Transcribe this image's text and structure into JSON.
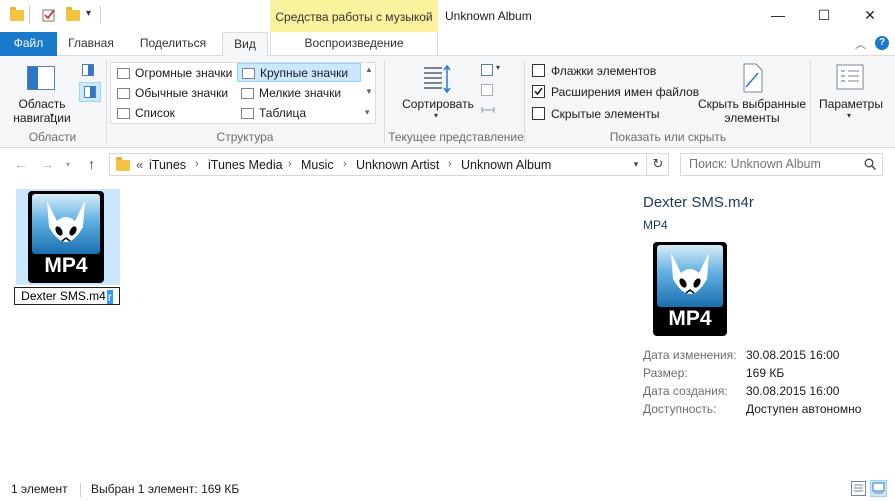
{
  "window": {
    "title": "Unknown Album",
    "context_tab_group": "Средства работы с музыкой",
    "minimize": "—",
    "maximize": "☐",
    "close": "✕"
  },
  "ribbon_tabs": {
    "file": "Файл",
    "home": "Главная",
    "share": "Поделиться",
    "view": "Вид",
    "playback": "Воспроизведение"
  },
  "ribbon": {
    "panes": {
      "nav_pane_label": "Область навигации",
      "group": "Области"
    },
    "layout": {
      "group": "Структура",
      "items": [
        "Огромные значки",
        "Крупные значки",
        "Обычные значки",
        "Мелкие значки",
        "Список",
        "Таблица"
      ],
      "selected": "Крупные значки"
    },
    "current_view": {
      "sort_label": "Сортировать",
      "group": "Текущее представление"
    },
    "show_hide": {
      "group": "Показать или скрыть",
      "checkboxes": [
        {
          "label": "Флажки элементов",
          "checked": false
        },
        {
          "label": "Расширения имен файлов",
          "checked": true
        },
        {
          "label": "Скрытые элементы",
          "checked": false
        }
      ],
      "hide_selected_label": "Скрыть выбранные элементы"
    },
    "options_label": "Параметры"
  },
  "address": {
    "prefix": "«",
    "crumbs": [
      "iTunes",
      "iTunes Media",
      "Music",
      "Unknown Artist",
      "Unknown Album"
    ],
    "separator": "›"
  },
  "search": {
    "placeholder": "Поиск: Unknown Album"
  },
  "file": {
    "name": "Dexter SMS.m4r",
    "rename_text": "Dexter SMS.m4",
    "rename_selected": "r",
    "icon_label": "MP4"
  },
  "preview": {
    "name": "Dexter SMS.m4r",
    "type": "MP4",
    "icon_label": "MP4",
    "properties": [
      {
        "key": "Дата изменения:",
        "value": "30.08.2015 16:00"
      },
      {
        "key": "Размер:",
        "value": "169 КБ"
      },
      {
        "key": "Дата создания:",
        "value": "30.08.2015 16:00"
      },
      {
        "key": "Доступность:",
        "value": "Доступен автономно"
      }
    ]
  },
  "status": {
    "count": "1 элемент",
    "selection": "Выбран 1 элемент: 169 КБ"
  },
  "colors": {
    "accent": "#1979ca",
    "context_tab": "#fbf29e",
    "selection": "#cce8ff"
  }
}
